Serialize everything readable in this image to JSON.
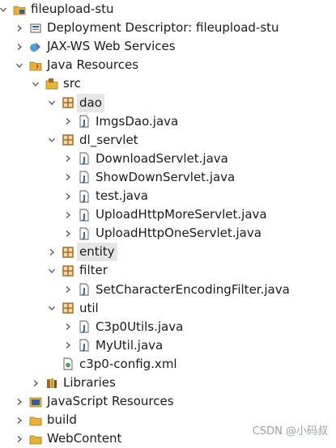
{
  "tree": [
    {
      "label": "fileupload-stu",
      "icon": "project-icon",
      "toggle": "expanded",
      "depth": 0
    },
    {
      "label": "Deployment Descriptor: fileupload-stu",
      "icon": "deployment-descriptor-icon",
      "toggle": "collapsed",
      "depth": 1
    },
    {
      "label": "JAX-WS Web Services",
      "icon": "web-services-icon",
      "toggle": "collapsed",
      "depth": 1
    },
    {
      "label": "Java Resources",
      "icon": "java-resources-icon",
      "toggle": "expanded",
      "depth": 1
    },
    {
      "label": "src",
      "icon": "source-folder-icon",
      "toggle": "expanded",
      "depth": 2
    },
    {
      "label": "dao",
      "icon": "package-icon",
      "toggle": "expanded",
      "depth": 3,
      "selected": true
    },
    {
      "label": "ImgsDao.java",
      "icon": "java-file-icon",
      "toggle": "collapsed",
      "depth": 4
    },
    {
      "label": "dl_servlet",
      "icon": "package-icon",
      "toggle": "expanded",
      "depth": 3
    },
    {
      "label": "DownloadServlet.java",
      "icon": "java-file-icon",
      "toggle": "collapsed",
      "depth": 4
    },
    {
      "label": "ShowDownServlet.java",
      "icon": "java-file-icon",
      "toggle": "collapsed",
      "depth": 4
    },
    {
      "label": "test.java",
      "icon": "java-file-icon",
      "toggle": "collapsed",
      "depth": 4
    },
    {
      "label": "UploadHttpMoreServlet.java",
      "icon": "java-file-icon",
      "toggle": "collapsed",
      "depth": 4
    },
    {
      "label": "UploadHttpOneServlet.java",
      "icon": "java-file-icon",
      "toggle": "collapsed",
      "depth": 4
    },
    {
      "label": "entity",
      "icon": "package-icon",
      "toggle": "collapsed",
      "depth": 3,
      "selected": true
    },
    {
      "label": "filter",
      "icon": "package-icon",
      "toggle": "expanded",
      "depth": 3
    },
    {
      "label": "SetCharacterEncodingFilter.java",
      "icon": "java-file-icon",
      "toggle": "collapsed",
      "depth": 4
    },
    {
      "label": "util",
      "icon": "package-icon",
      "toggle": "expanded",
      "depth": 3
    },
    {
      "label": "C3p0Utils.java",
      "icon": "java-file-icon",
      "toggle": "collapsed",
      "depth": 4
    },
    {
      "label": "MyUtil.java",
      "icon": "java-file-icon",
      "toggle": "collapsed",
      "depth": 4
    },
    {
      "label": "c3p0-config.xml",
      "icon": "xml-file-icon",
      "toggle": "none",
      "depth": 3
    },
    {
      "label": "Libraries",
      "icon": "libraries-icon",
      "toggle": "collapsed",
      "depth": 2
    },
    {
      "label": "JavaScript Resources",
      "icon": "javascript-resources-icon",
      "toggle": "collapsed",
      "depth": 1
    },
    {
      "label": "build",
      "icon": "folder-icon",
      "toggle": "collapsed",
      "depth": 1
    },
    {
      "label": "WebContent",
      "icon": "folder-icon",
      "toggle": "collapsed",
      "depth": 1
    }
  ],
  "watermark": "CSDN @小码叔",
  "colors": {
    "package": "#a0671f",
    "java": "#2f5ea8",
    "folder": "#e8b23a",
    "toggle": "#555555",
    "selection": "#e6e6e6"
  }
}
